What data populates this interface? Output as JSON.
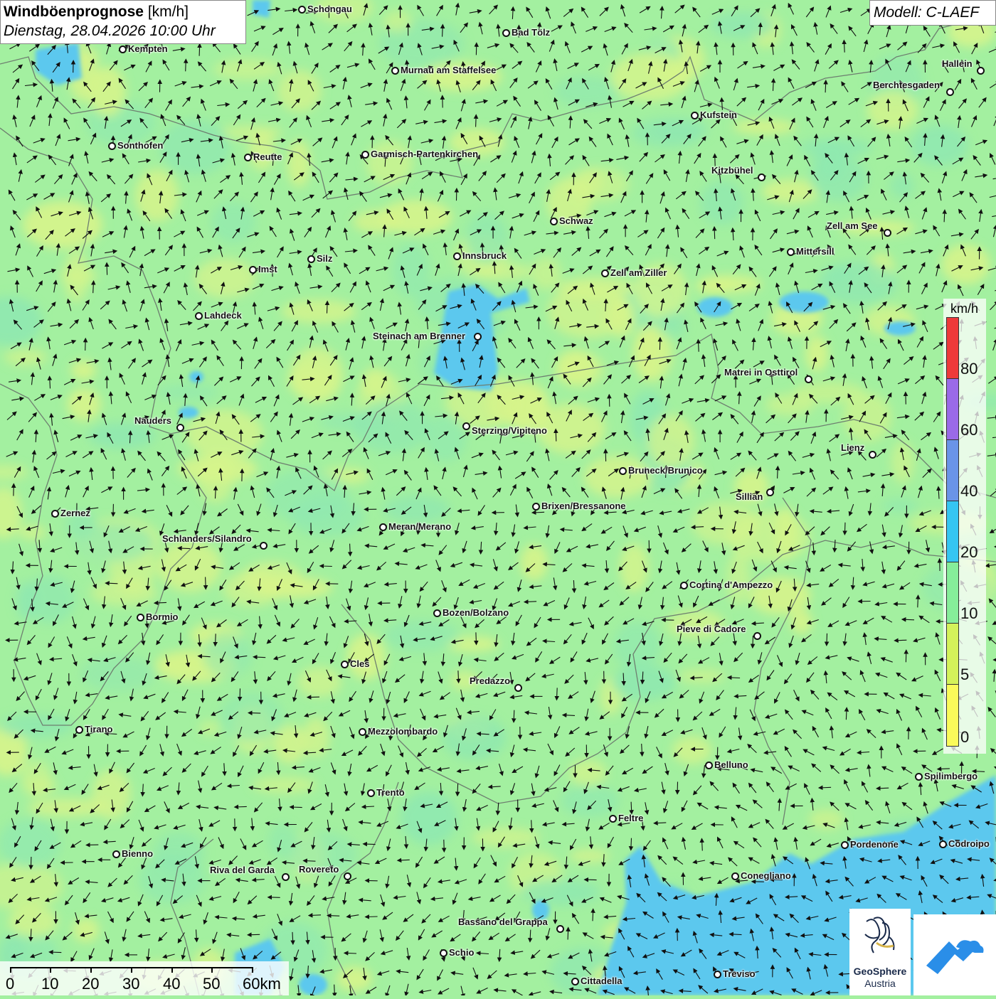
{
  "header": {
    "title": "Windböenprognose",
    "unit": "[km/h]",
    "datetime": "Dienstag, 28.04.2026 10:00 Uhr"
  },
  "model": {
    "label": "Modell: C-LAEF"
  },
  "legend": {
    "unit": "km/h",
    "labels": [
      "80",
      "60",
      "40",
      "20",
      "10",
      "5",
      "0"
    ],
    "colors": [
      "#ee3a3a",
      "#9a6ae8",
      "#6a94e8",
      "#35c6f2",
      "#86ee9a",
      "#d4f25a",
      "#fafa5a"
    ]
  },
  "scale_bar": {
    "labels": [
      "0",
      "10",
      "20",
      "30",
      "40",
      "50",
      "60km"
    ]
  },
  "logos": {
    "geosphere_line1": "GeoSphere",
    "geosphere_line2": "Austria"
  },
  "background_colors": {
    "land": "#a3f0a0",
    "land_high": "#d8f48a",
    "land_mid": "#8fe8b0",
    "water": "#5cc8ee",
    "water_glacier": "#b9d8f0"
  },
  "cities": [
    {
      "name": "Schongau"
    },
    {
      "name": "Bad Tölz"
    },
    {
      "name": "Kempten"
    },
    {
      "name": "Murnau am Staffelsee"
    },
    {
      "name": "Hallein"
    },
    {
      "name": "Berchtesgaden"
    },
    {
      "name": "Kufstein"
    },
    {
      "name": "Sonthofen"
    },
    {
      "name": "Reutte"
    },
    {
      "name": "Garmisch-Partenkirchen"
    },
    {
      "name": "Kitzbühel"
    },
    {
      "name": "Schwaz"
    },
    {
      "name": "Zell am See"
    },
    {
      "name": "Mittersill"
    },
    {
      "name": "Imst"
    },
    {
      "name": "Silz"
    },
    {
      "name": "Innsbruck"
    },
    {
      "name": "Zell am Ziller"
    },
    {
      "name": "Lahdeck"
    },
    {
      "name": "Steinach am Brenner"
    },
    {
      "name": "Matrei in Osttirol"
    },
    {
      "name": "Nauders"
    },
    {
      "name": "Sterzing/Vipiteno"
    },
    {
      "name": "Lienz"
    },
    {
      "name": "Bruneck/Brunico"
    },
    {
      "name": "Sillian"
    },
    {
      "name": "Brixen/Bressanone"
    },
    {
      "name": "Zernez"
    },
    {
      "name": "Meran/Merano"
    },
    {
      "name": "Schlanders/Silandro"
    },
    {
      "name": "Cortina d'Ampezzo"
    },
    {
      "name": "Bozen/Bolzano"
    },
    {
      "name": "Bormio"
    },
    {
      "name": "Pieve di Cadore"
    },
    {
      "name": "Cles"
    },
    {
      "name": "Predazzo"
    },
    {
      "name": "Tirano"
    },
    {
      "name": "Mezzolombardo"
    },
    {
      "name": "Belluno"
    },
    {
      "name": "Spilimbergo"
    },
    {
      "name": "Trento"
    },
    {
      "name": "Feltre"
    },
    {
      "name": "Pordenone"
    },
    {
      "name": "Codroipo"
    },
    {
      "name": "Bienno"
    },
    {
      "name": "Riva del Garda"
    },
    {
      "name": "Rovereto"
    },
    {
      "name": "Conegliano"
    },
    {
      "name": "Bassano del Grappa"
    },
    {
      "name": "Schio"
    },
    {
      "name": "Treviso"
    },
    {
      "name": "Cittadella"
    }
  ]
}
